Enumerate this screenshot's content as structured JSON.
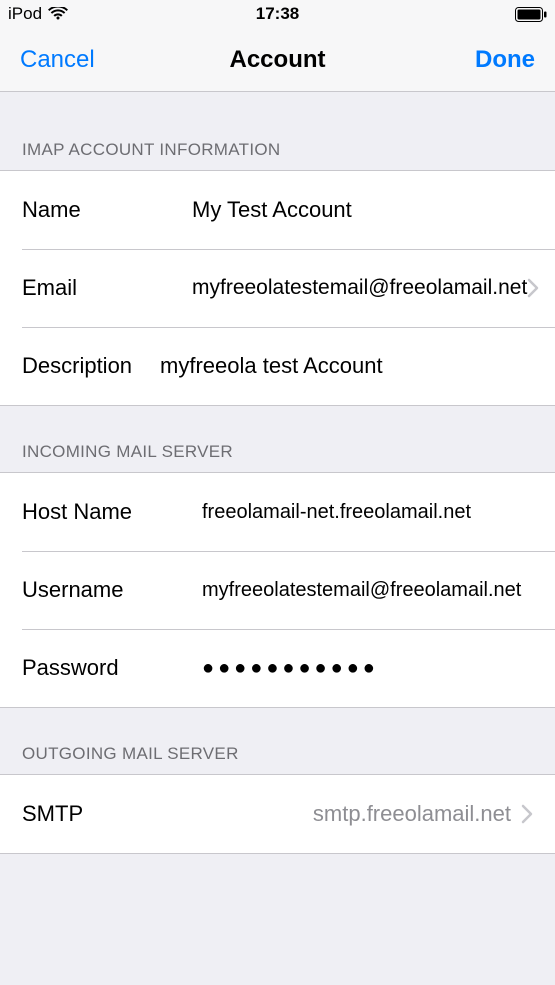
{
  "statusBar": {
    "carrier": "iPod",
    "time": "17:38"
  },
  "navBar": {
    "cancel": "Cancel",
    "title": "Account",
    "done": "Done"
  },
  "sections": {
    "imap": {
      "header": "IMAP ACCOUNT INFORMATION",
      "name": {
        "label": "Name",
        "value": "My Test Account"
      },
      "email": {
        "label": "Email",
        "value": "myfreeolatestemail@freeolamail.net"
      },
      "description": {
        "label": "Description",
        "value": "myfreeola test Account"
      }
    },
    "incoming": {
      "header": "INCOMING MAIL SERVER",
      "host": {
        "label": "Host Name",
        "value": "freeolamail-net.freeolamail.net"
      },
      "username": {
        "label": "Username",
        "value": "myfreeolatestemail@freeolamail.net"
      },
      "password": {
        "label": "Password",
        "value": "●●●●●●●●●●●"
      }
    },
    "outgoing": {
      "header": "OUTGOING MAIL SERVER",
      "smtp": {
        "label": "SMTP",
        "value": "smtp.freeolamail.net"
      }
    }
  }
}
